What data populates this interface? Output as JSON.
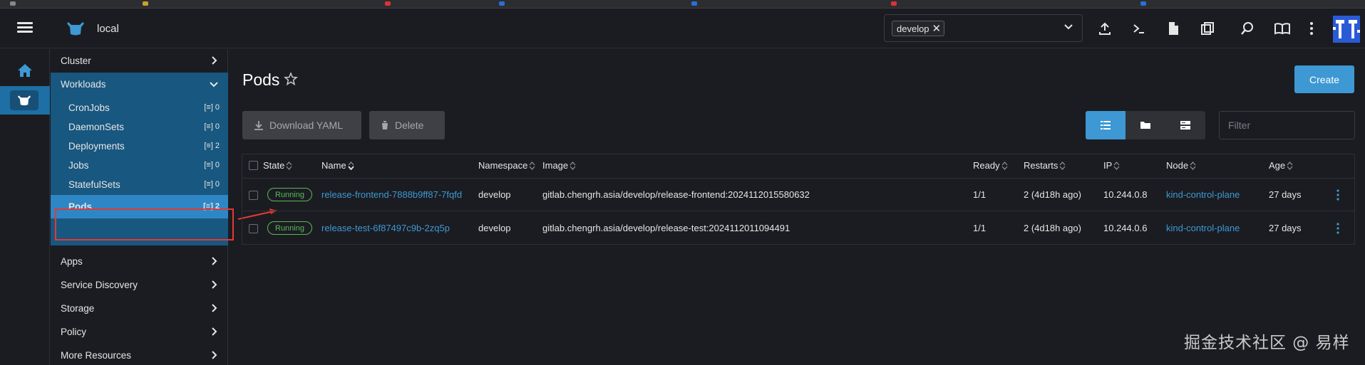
{
  "header": {
    "cluster_name": "local",
    "namespace_chip": "develop"
  },
  "nav": {
    "cluster": "Cluster",
    "workloads": "Workloads",
    "workload_items": [
      {
        "label": "CronJobs",
        "count": "0"
      },
      {
        "label": "DaemonSets",
        "count": "0"
      },
      {
        "label": "Deployments",
        "count": "2"
      },
      {
        "label": "Jobs",
        "count": "0"
      },
      {
        "label": "StatefulSets",
        "count": "0"
      },
      {
        "label": "Pods",
        "count": "2"
      }
    ],
    "sections": [
      "Apps",
      "Service Discovery",
      "Storage",
      "Policy",
      "More Resources"
    ]
  },
  "main": {
    "title": "Pods",
    "create_label": "Create",
    "download_label": "Download YAML",
    "delete_label": "Delete",
    "filter_placeholder": "Filter"
  },
  "table": {
    "columns": [
      "State",
      "Name",
      "Namespace",
      "Image",
      "Ready",
      "Restarts",
      "IP",
      "Node",
      "Age"
    ],
    "rows": [
      {
        "state": "Running",
        "name": "release-frontend-7888b9ff87-7fqfd",
        "namespace": "develop",
        "image": "gitlab.chengrh.asia/develop/release-frontend:2024112015580632",
        "ready": "1/1",
        "restarts": "2 (4d18h ago)",
        "ip": "10.244.0.8",
        "node": "kind-control-plane",
        "age": "27 days"
      },
      {
        "state": "Running",
        "name": "release-test-6f87497c9b-2zq5p",
        "namespace": "develop",
        "image": "gitlab.chengrh.asia/develop/release-test:2024112011094491",
        "ready": "1/1",
        "restarts": "2 (4d18h ago)",
        "ip": "10.244.0.6",
        "node": "kind-control-plane",
        "age": "27 days"
      }
    ]
  },
  "watermark": "掘金技术社区 @ 易样",
  "colors": {
    "accent": "#3d98d3",
    "nav_group": "#18577f",
    "nav_active": "#2e86c4",
    "running": "#5cb85c",
    "highlight": "#e53935"
  }
}
